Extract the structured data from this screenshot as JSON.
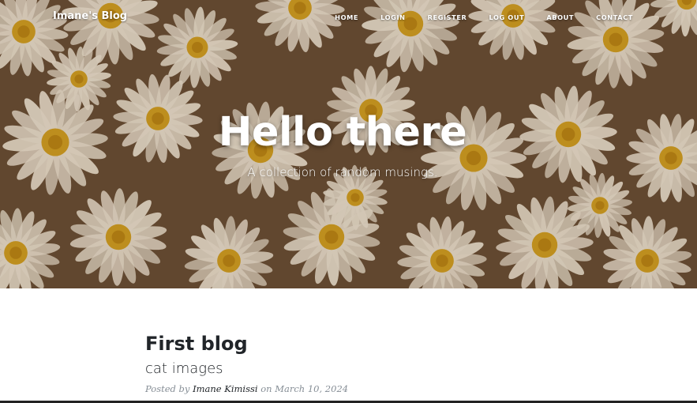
{
  "navbar": {
    "brand": "Imane's Blog",
    "links": [
      "HOME",
      "LOGIN",
      "REGISTER",
      "LOG OUT",
      "ABOUT",
      "CONTACT"
    ]
  },
  "hero": {
    "heading": "Hello there",
    "subheading": "A collection of random musings.",
    "background": "daisy-flowers-photo"
  },
  "posts": [
    {
      "title": "First blog",
      "subtitle": "cat images",
      "meta_prefix": "Posted by",
      "author": "Imane Kimissi",
      "meta_mid": "on",
      "date": "March 10, 2024"
    }
  ],
  "colors": {
    "hero_tint": "#6a4f35",
    "text_dark": "#212529",
    "meta_gray": "#868e96",
    "petal": "#f4ead8",
    "center": "#d9a520"
  }
}
